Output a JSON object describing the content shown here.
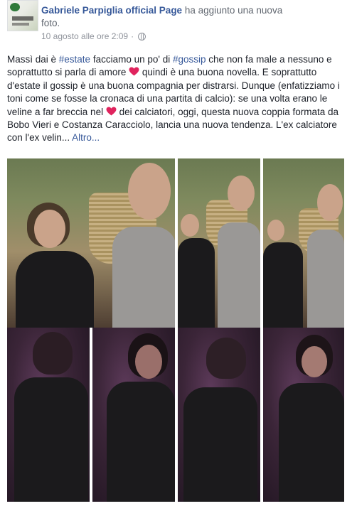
{
  "post": {
    "author": "Gabriele Parpiglia official Page",
    "action_line1": " ha aggiunto una nuova",
    "action_line2": "foto.",
    "timestamp": "10 agosto alle ore 2:09",
    "separator": "·",
    "privacy_icon": "globe-icon"
  },
  "text": {
    "p1": "Massì dai è ",
    "tag1": "#estate",
    "p2": " facciamo un po' di ",
    "tag2": "#gossip",
    "p3": " che non fa male a nessuno e soprattutto si parla di amore ",
    "p4": " quindi è una buona novella. E soprattutto d'estate il gossip è una buona compagnia per distrarsi. Dunque (enfatizziamo i toni come se fosse la cronaca di una partita di calcio): se una volta erano le veline a far breccia nel ",
    "p5": " dei calciatori, oggi, questa nuova coppia formata da Bobo Vieri e Costanza Caracciolo, lancia una nuova tendenza. L'ex calciatore con l'ex velin... ",
    "more": "Altro..."
  },
  "colors": {
    "link": "#365899",
    "heart": "#e0245e"
  },
  "photos": {
    "count_visible": 7
  }
}
